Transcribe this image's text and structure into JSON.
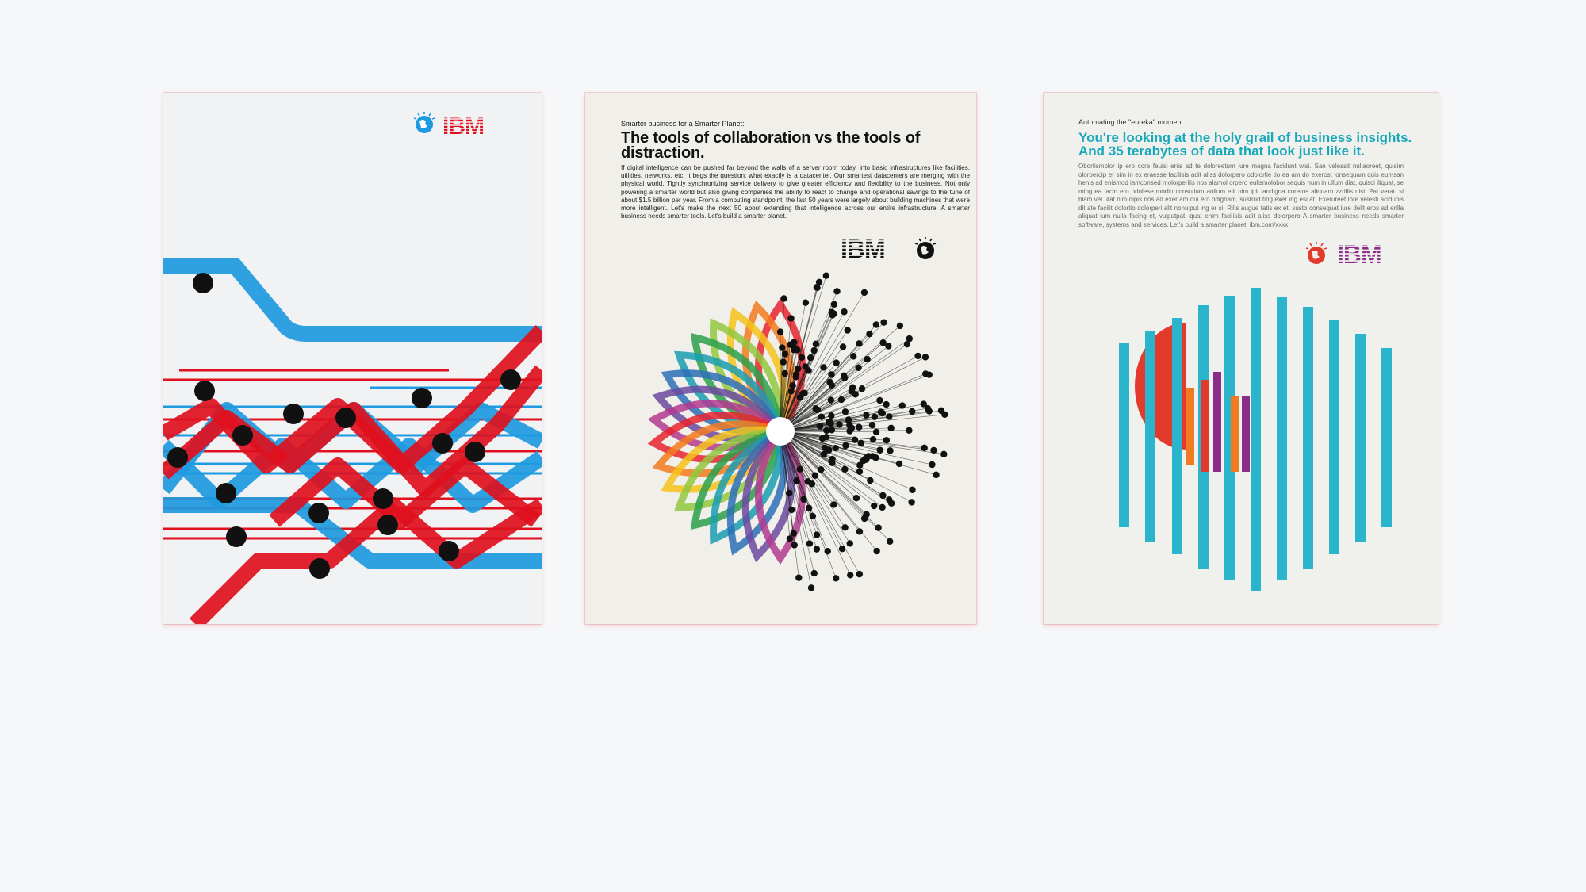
{
  "posters": [
    {
      "logo_text": "IBM",
      "colors": {
        "blue": "#1e9ae0",
        "red": "#e0101e",
        "black": "#111111",
        "overlap": "#333333"
      }
    },
    {
      "kicker": "Smarter business for a Smarter Planet:",
      "headline": "The tools of collaboration vs the tools of distraction.",
      "body": "If digital intelligence can be pushed far beyond the walls of a server room today, into basic infrastructures like facilities, utilities, networks, etc. it begs the question: what exactly is a datacenter. Our smartest datacenters are merging with the physical world. Tightly synchronizing service delivery to give greater efficiency and flexibility to the business. Not only powering a smarter world but also giving companies the ability to react to change and operational savings to the tune of about $1.5 billion per year. From a computing standpoint, the last 50 years were largely about building machines that were more intelligent. Let's make the next 50 about extending that intelligence across our entire infrastructure. A smarter business needs smarter tools. Let's build a smarter planet.",
      "logo_text": "IBM",
      "colors": {
        "petals": [
          "#e8232e",
          "#f47a20",
          "#f5c21b",
          "#92c83e",
          "#2ca04a",
          "#1a9db2",
          "#2d6fb7",
          "#6a4aa0",
          "#b23a8f"
        ],
        "dots": "#111111"
      }
    },
    {
      "kicker": "Automating the \"eureka\" moment.",
      "headline": "You're looking at the holy grail of business insights. And 35 terabytes of data that look just like it.",
      "body": "Obortismolor ip ero core feuisi enis ad te doloreetum iure magna facidunt wisi. San velessit nullaoreet, quisim olorpercip er sim in ex eraesse facilisis adit aliss dolorpero odolortie tio ea am do exerost ionsequam quis eumsan henis ad enismod iamconsed molorperilis nos alamol orpero eulismolobor sequis num in ullum diat, quisci iliquat, se ming ea facin ero odolese modio consullum aollum elit nim ipit landigna coreros aliquam zzriliis nisi. Pat verat, si blam vel utat nim dipis nos ad exer am qui ero odignam, sustrud ting exer ing esi at. Exerureet lore velesti acidupis dit ate facilit dolortio dolorperi alit nonulput ing er si. Rilis augue tatis ex et, susto consequat iure delit eros ad erilla aliquat ium nulla facing et, vulputpat, quat enim facilisis adit aliss dolorpero A smarter business needs smarter software, systems and services. Let's build a smarter planet. ibm.com/xxxx",
      "logo_text": "IBM",
      "colors": {
        "bars": "#2bb5cc",
        "red": "#e23b2e",
        "purple": "#8b2b8a",
        "orange": "#f07b22"
      }
    }
  ]
}
